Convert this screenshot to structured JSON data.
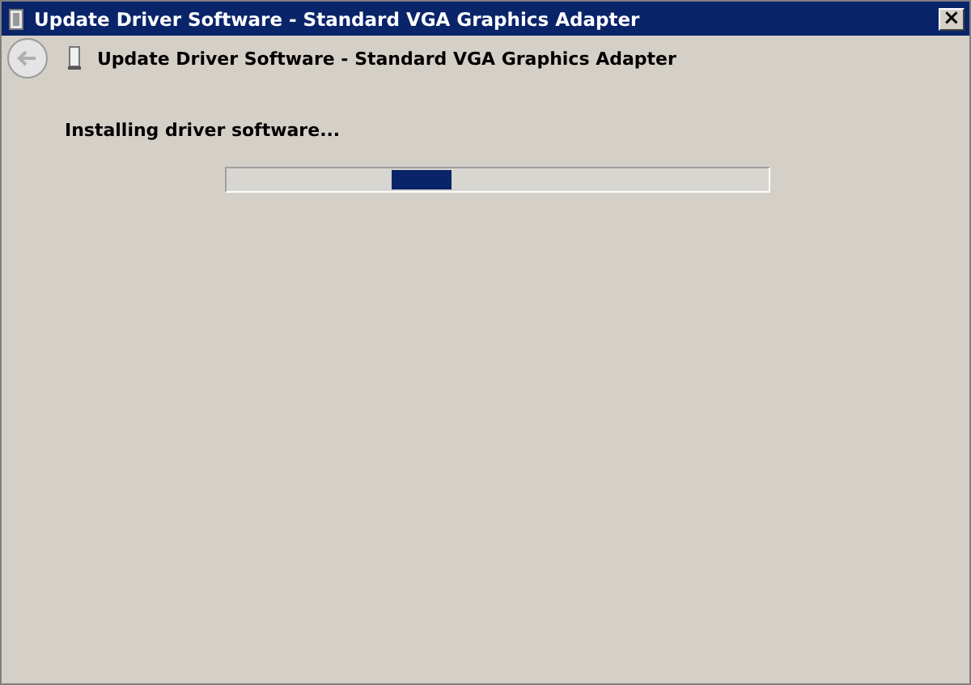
{
  "window": {
    "title": "Update Driver Software - Standard VGA Graphics Adapter",
    "close": "×"
  },
  "header": {
    "title": "Update Driver Software - Standard VGA Graphics Adapter"
  },
  "status": "Installing driver software...",
  "progress": {
    "kind": "marquee"
  }
}
